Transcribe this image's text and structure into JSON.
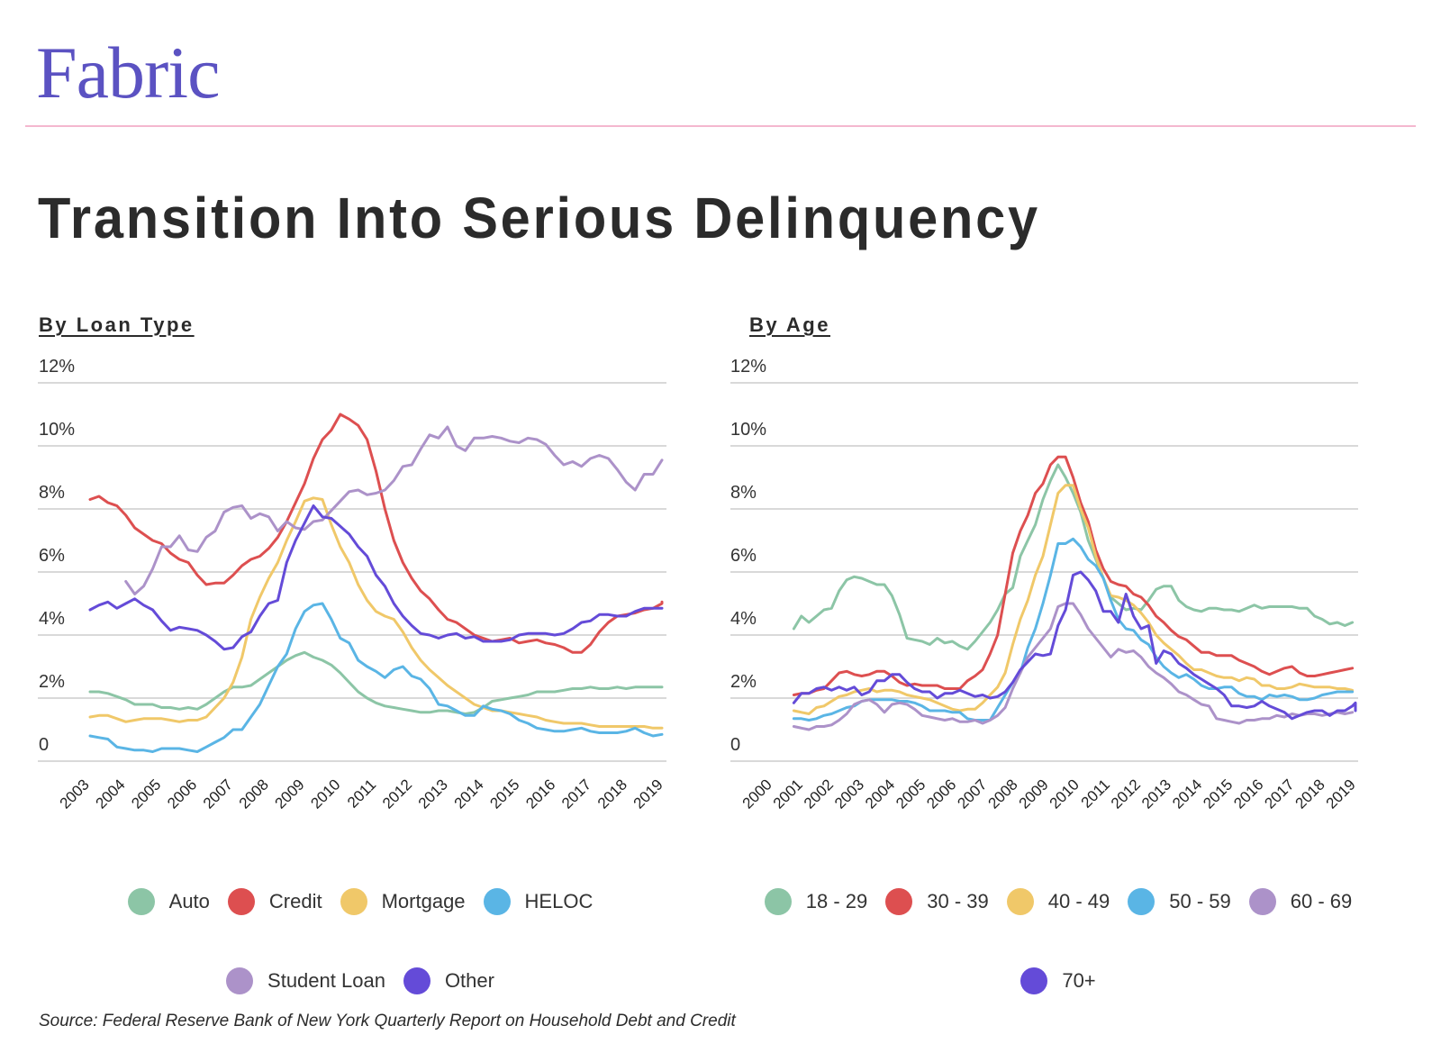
{
  "brand": {
    "logo_text": "Fabric",
    "logo_color": "#5b52c2",
    "rule_color": "#f4b8cf"
  },
  "title": "Transition Into Serious Delinquency",
  "source": "Source: Federal Reserve Bank of New York Quarterly Report on Household Debt and Credit",
  "chart_data": [
    {
      "type": "line",
      "title": "By Loan Type",
      "xlabel": "",
      "ylabel": "",
      "ylim": [
        0,
        12
      ],
      "yticks": [
        0,
        2,
        4,
        6,
        8,
        10,
        12
      ],
      "ytick_labels": [
        "0",
        "2%",
        "4%",
        "6%",
        "8%",
        "10%",
        "12%"
      ],
      "xticks": [
        "2003",
        "2004",
        "2005",
        "2006",
        "2007",
        "2008",
        "2009",
        "2010",
        "2011",
        "2012",
        "2013",
        "2014",
        "2015",
        "2016",
        "2017",
        "2018",
        "2019"
      ],
      "x_range": [
        2003,
        2019
      ],
      "grid": true,
      "legend_position": "bottom",
      "series": [
        {
          "name": "Auto",
          "color": "#8cc5a6",
          "x_start": 2003,
          "step": 0.25,
          "values": [
            2.2,
            2.2,
            2.15,
            2.05,
            1.95,
            1.8,
            1.8,
            1.8,
            1.7,
            1.7,
            1.65,
            1.7,
            1.65,
            1.8,
            2.0,
            2.2,
            2.35,
            2.35,
            2.4,
            2.6,
            2.8,
            3.0,
            3.2,
            3.35,
            3.45,
            3.3,
            3.2,
            3.05,
            2.8,
            2.5,
            2.2,
            2.0,
            1.85,
            1.75,
            1.7,
            1.65,
            1.6,
            1.55,
            1.55,
            1.6,
            1.6,
            1.55,
            1.5,
            1.55,
            1.7,
            1.9,
            1.95,
            2.0,
            2.05,
            2.1,
            2.2,
            2.2,
            2.2,
            2.25,
            2.3,
            2.3,
            2.35,
            2.3,
            2.3,
            2.35,
            2.3,
            2.35,
            2.35,
            2.35,
            2.35
          ]
        },
        {
          "name": "Credit",
          "color": "#dd4f50",
          "x_start": 2003,
          "step": 0.25,
          "values": [
            8.3,
            8.4,
            8.2,
            8.1,
            7.8,
            7.4,
            7.2,
            7.0,
            6.9,
            6.6,
            6.4,
            6.3,
            5.9,
            5.6,
            5.65,
            5.65,
            5.9,
            6.2,
            6.4,
            6.5,
            6.75,
            7.1,
            7.6,
            8.2,
            8.8,
            9.6,
            10.2,
            10.5,
            11.0,
            10.85,
            10.65,
            10.2,
            9.2,
            8.0,
            7.0,
            6.3,
            5.8,
            5.4,
            5.15,
            4.8,
            4.5,
            4.4,
            4.2,
            4.0,
            3.9,
            3.8,
            3.85,
            3.9,
            3.75,
            3.8,
            3.85,
            3.75,
            3.7,
            3.6,
            3.45,
            3.45,
            3.7,
            4.1,
            4.4,
            4.6,
            4.65,
            4.7,
            4.8,
            4.85,
            5.0,
            5.05
          ]
        },
        {
          "name": "Mortgage",
          "color": "#f0c869",
          "x_start": 2003,
          "step": 0.25,
          "values": [
            1.4,
            1.45,
            1.45,
            1.35,
            1.25,
            1.3,
            1.35,
            1.35,
            1.35,
            1.3,
            1.25,
            1.3,
            1.3,
            1.4,
            1.7,
            2.0,
            2.5,
            3.3,
            4.5,
            5.2,
            5.8,
            6.3,
            7.0,
            7.6,
            8.25,
            8.35,
            8.3,
            7.5,
            6.8,
            6.3,
            5.6,
            5.1,
            4.75,
            4.6,
            4.5,
            4.1,
            3.6,
            3.2,
            2.9,
            2.65,
            2.4,
            2.2,
            2.0,
            1.8,
            1.7,
            1.6,
            1.6,
            1.55,
            1.5,
            1.45,
            1.4,
            1.3,
            1.25,
            1.2,
            1.2,
            1.2,
            1.15,
            1.1,
            1.1,
            1.1,
            1.1,
            1.1,
            1.1,
            1.05,
            1.05
          ]
        },
        {
          "name": "HELOC",
          "color": "#5ab5e5",
          "x_start": 2003,
          "step": 0.25,
          "values": [
            0.8,
            0.75,
            0.7,
            0.45,
            0.4,
            0.35,
            0.35,
            0.3,
            0.4,
            0.4,
            0.4,
            0.35,
            0.3,
            0.45,
            0.6,
            0.75,
            1.0,
            1.0,
            1.4,
            1.8,
            2.4,
            3.0,
            3.4,
            4.2,
            4.75,
            4.95,
            5.0,
            4.5,
            3.9,
            3.75,
            3.2,
            3.0,
            2.85,
            2.65,
            2.9,
            3.0,
            2.7,
            2.6,
            2.3,
            1.8,
            1.75,
            1.6,
            1.45,
            1.45,
            1.75,
            1.65,
            1.6,
            1.5,
            1.3,
            1.2,
            1.05,
            1.0,
            0.95,
            0.95,
            1.0,
            1.05,
            0.95,
            0.9,
            0.9,
            0.9,
            0.95,
            1.05,
            0.9,
            0.8,
            0.85
          ]
        },
        {
          "name": "Student Loan",
          "color": "#ac92c9",
          "x_start": 2004,
          "step": 0.25,
          "values": [
            5.7,
            5.3,
            5.55,
            6.1,
            6.8,
            6.8,
            7.15,
            6.7,
            6.65,
            7.1,
            7.3,
            7.9,
            8.05,
            8.1,
            7.7,
            7.85,
            7.75,
            7.3,
            7.6,
            7.4,
            7.35,
            7.6,
            7.65,
            7.95,
            8.25,
            8.55,
            8.6,
            8.45,
            8.5,
            8.6,
            8.9,
            9.35,
            9.4,
            9.9,
            10.35,
            10.25,
            10.6,
            10.0,
            9.85,
            10.25,
            10.25,
            10.3,
            10.25,
            10.15,
            10.1,
            10.25,
            10.2,
            10.05,
            9.7,
            9.4,
            9.5,
            9.35,
            9.6,
            9.7,
            9.6,
            9.25,
            8.85,
            8.6,
            9.1,
            9.1,
            9.55
          ]
        },
        {
          "name": "Other",
          "color": "#644bd8",
          "x_start": 2003,
          "step": 0.25,
          "values": [
            4.8,
            4.95,
            5.05,
            4.85,
            5.0,
            5.15,
            4.95,
            4.8,
            4.45,
            4.15,
            4.25,
            4.2,
            4.15,
            4.0,
            3.8,
            3.55,
            3.6,
            3.95,
            4.1,
            4.6,
            5.0,
            5.1,
            6.3,
            7.0,
            7.55,
            8.1,
            7.75,
            7.7,
            7.45,
            7.2,
            6.8,
            6.5,
            5.9,
            5.55,
            5.0,
            4.6,
            4.3,
            4.05,
            4.0,
            3.9,
            4.0,
            4.05,
            3.9,
            3.95,
            3.8,
            3.8,
            3.8,
            3.85,
            4.0,
            4.05,
            4.05,
            4.05,
            4.0,
            4.05,
            4.2,
            4.4,
            4.45,
            4.65,
            4.65,
            4.6,
            4.6,
            4.75,
            4.85,
            4.85,
            4.85,
            4.85
          ]
        }
      ]
    },
    {
      "type": "line",
      "title": "By Age",
      "xlabel": "",
      "ylabel": "",
      "ylim": [
        0,
        12
      ],
      "yticks": [
        0,
        2,
        4,
        6,
        8,
        10,
        12
      ],
      "ytick_labels": [
        "0",
        "2%",
        "4%",
        "6%",
        "8%",
        "10%",
        "12%"
      ],
      "xticks": [
        "2000",
        "2001",
        "2002",
        "2003",
        "2004",
        "2005",
        "2006",
        "2007",
        "2008",
        "2009",
        "2010",
        "2011",
        "2012",
        "2013",
        "2014",
        "2015",
        "2016",
        "2017",
        "2018",
        "2019"
      ],
      "x_range": [
        2000,
        2019
      ],
      "grid": true,
      "legend_position": "bottom",
      "series": [
        {
          "name": "18 - 29",
          "color": "#8cc5a6",
          "x_start": 2000.4,
          "step": 0.25,
          "values": [
            4.2,
            4.6,
            4.4,
            4.6,
            4.8,
            4.85,
            5.4,
            5.75,
            5.85,
            5.8,
            5.7,
            5.6,
            5.6,
            5.25,
            4.65,
            3.9,
            3.85,
            3.8,
            3.7,
            3.9,
            3.75,
            3.8,
            3.65,
            3.55,
            3.8,
            4.1,
            4.4,
            4.8,
            5.3,
            5.5,
            6.5,
            7.0,
            7.5,
            8.3,
            8.9,
            9.4,
            9.0,
            8.5,
            7.9,
            7.0,
            6.4,
            5.8,
            5.2,
            5.0,
            4.8,
            4.85,
            4.8,
            5.1,
            5.45,
            5.55,
            5.55,
            5.1,
            4.9,
            4.8,
            4.75,
            4.85,
            4.85,
            4.8,
            4.8,
            4.75,
            4.85,
            4.95,
            4.85,
            4.9,
            4.9,
            4.9,
            4.9,
            4.85,
            4.85,
            4.6,
            4.5,
            4.35,
            4.4,
            4.3,
            4.4
          ]
        },
        {
          "name": "30 - 39",
          "color": "#dd4f50",
          "x_start": 2000.4,
          "step": 0.25,
          "values": [
            2.1,
            2.15,
            2.15,
            2.25,
            2.3,
            2.55,
            2.8,
            2.85,
            2.75,
            2.7,
            2.75,
            2.85,
            2.85,
            2.7,
            2.5,
            2.4,
            2.45,
            2.4,
            2.4,
            2.4,
            2.3,
            2.3,
            2.3,
            2.55,
            2.7,
            2.9,
            3.4,
            4.0,
            5.3,
            6.6,
            7.3,
            7.8,
            8.5,
            8.8,
            9.4,
            9.65,
            9.65,
            9.0,
            8.2,
            7.6,
            6.7,
            6.1,
            5.7,
            5.6,
            5.55,
            5.3,
            5.2,
            4.95,
            4.6,
            4.4,
            4.15,
            3.95,
            3.85,
            3.65,
            3.45,
            3.45,
            3.35,
            3.35,
            3.35,
            3.2,
            3.1,
            3.0,
            2.85,
            2.75,
            2.85,
            2.95,
            3.0,
            2.8,
            2.7,
            2.7,
            2.75,
            2.8,
            2.85,
            2.9,
            2.95
          ]
        },
        {
          "name": "40 - 49",
          "color": "#f0c869",
          "x_start": 2000.4,
          "step": 0.25,
          "values": [
            1.6,
            1.55,
            1.5,
            1.7,
            1.75,
            1.9,
            2.05,
            2.1,
            2.2,
            2.25,
            2.3,
            2.2,
            2.25,
            2.25,
            2.2,
            2.1,
            2.05,
            2.0,
            1.95,
            1.85,
            1.75,
            1.65,
            1.6,
            1.65,
            1.65,
            1.85,
            2.1,
            2.35,
            2.8,
            3.7,
            4.5,
            5.1,
            5.9,
            6.5,
            7.5,
            8.5,
            8.75,
            8.75,
            8.0,
            7.4,
            6.5,
            5.8,
            5.25,
            5.2,
            5.1,
            4.95,
            4.7,
            4.4,
            4.0,
            3.75,
            3.55,
            3.35,
            3.1,
            2.9,
            2.9,
            2.8,
            2.7,
            2.65,
            2.65,
            2.55,
            2.65,
            2.6,
            2.4,
            2.4,
            2.3,
            2.3,
            2.35,
            2.45,
            2.4,
            2.35,
            2.35,
            2.35,
            2.3,
            2.3,
            2.25
          ]
        },
        {
          "name": "50 - 59",
          "color": "#5ab5e5",
          "x_start": 2000.4,
          "step": 0.25,
          "values": [
            1.35,
            1.35,
            1.3,
            1.35,
            1.45,
            1.5,
            1.6,
            1.7,
            1.75,
            1.9,
            1.95,
            1.95,
            1.95,
            1.95,
            1.9,
            1.9,
            1.85,
            1.75,
            1.6,
            1.6,
            1.6,
            1.55,
            1.55,
            1.35,
            1.3,
            1.3,
            1.3,
            1.7,
            2.1,
            2.5,
            2.8,
            3.6,
            4.2,
            5.0,
            5.9,
            6.9,
            6.9,
            7.05,
            6.8,
            6.4,
            6.2,
            5.8,
            5.1,
            4.5,
            4.2,
            4.15,
            3.85,
            3.7,
            3.3,
            3.0,
            2.8,
            2.65,
            2.75,
            2.6,
            2.4,
            2.3,
            2.3,
            2.35,
            2.35,
            2.15,
            2.05,
            2.05,
            1.95,
            2.1,
            2.05,
            2.1,
            2.05,
            1.95,
            1.95,
            2.0,
            2.1,
            2.15,
            2.2,
            2.2,
            2.2
          ]
        },
        {
          "name": "60 - 69",
          "color": "#ac92c9",
          "x_start": 2000.4,
          "step": 0.25,
          "values": [
            1.1,
            1.05,
            1.0,
            1.1,
            1.1,
            1.15,
            1.3,
            1.5,
            1.8,
            1.9,
            1.95,
            1.8,
            1.55,
            1.8,
            1.85,
            1.8,
            1.65,
            1.45,
            1.4,
            1.35,
            1.3,
            1.35,
            1.25,
            1.25,
            1.3,
            1.2,
            1.3,
            1.45,
            1.7,
            2.3,
            2.8,
            3.3,
            3.6,
            3.9,
            4.2,
            4.9,
            5.0,
            5.0,
            4.65,
            4.2,
            3.9,
            3.6,
            3.3,
            3.55,
            3.45,
            3.5,
            3.3,
            3.0,
            2.8,
            2.65,
            2.45,
            2.2,
            2.1,
            1.95,
            1.8,
            1.75,
            1.35,
            1.3,
            1.25,
            1.2,
            1.3,
            1.3,
            1.35,
            1.35,
            1.45,
            1.4,
            1.5,
            1.45,
            1.5,
            1.5,
            1.45,
            1.5,
            1.55,
            1.5,
            1.55
          ]
        },
        {
          "name": "70+",
          "color": "#644bd8",
          "x_start": 2000.4,
          "step": 0.25,
          "values": [
            1.85,
            2.15,
            2.15,
            2.3,
            2.35,
            2.25,
            2.35,
            2.25,
            2.35,
            2.1,
            2.2,
            2.55,
            2.55,
            2.75,
            2.75,
            2.5,
            2.3,
            2.2,
            2.2,
            2.0,
            2.15,
            2.15,
            2.25,
            2.15,
            2.05,
            2.1,
            2.0,
            2.05,
            2.2,
            2.5,
            2.9,
            3.15,
            3.4,
            3.35,
            3.4,
            4.3,
            4.8,
            5.9,
            6.0,
            5.75,
            5.4,
            4.75,
            4.75,
            4.4,
            5.3,
            4.6,
            4.2,
            4.3,
            3.1,
            3.5,
            3.4,
            3.1,
            2.95,
            2.75,
            2.6,
            2.45,
            2.3,
            2.1,
            1.75,
            1.75,
            1.7,
            1.75,
            1.9,
            1.75,
            1.65,
            1.55,
            1.35,
            1.45,
            1.55,
            1.6,
            1.6,
            1.45,
            1.6,
            1.6,
            1.75,
            1.85,
            1.6
          ]
        }
      ]
    }
  ]
}
